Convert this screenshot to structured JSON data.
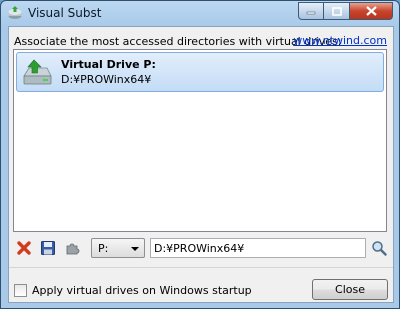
{
  "window": {
    "title": "Visual Subst"
  },
  "header": {
    "description": "Associate the most accessed directories with virtual drives:",
    "link": "www.ntwind.com"
  },
  "drives": [
    {
      "name": "Virtual Drive P:",
      "path": "D:¥PROWinx64¥"
    }
  ],
  "controls": {
    "drive_letter": "P:",
    "path_value": "D:¥PROWinx64¥"
  },
  "footer": {
    "startup_label": "Apply virtual drives on Windows startup",
    "startup_checked": false,
    "close_label": "Close"
  },
  "colors": {
    "selection": "#c3dcf6",
    "link": "#0033cc",
    "close_caption": "#c7452c"
  }
}
